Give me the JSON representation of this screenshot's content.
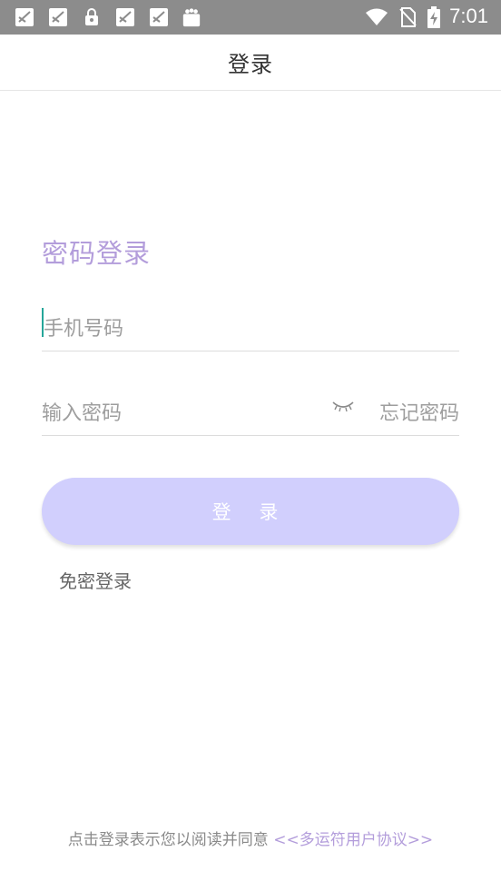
{
  "status_bar": {
    "time": "7:01",
    "left_icons": [
      "notification-icon",
      "notification-icon",
      "lock-icon",
      "notification-icon",
      "notification-icon",
      "shopping-bag-icon"
    ],
    "right_icons": [
      "wifi-icon",
      "sim-card-icon",
      "battery-charging-icon"
    ]
  },
  "header": {
    "title": "登录"
  },
  "login_form": {
    "heading": "密码登录",
    "phone_placeholder": "手机号码",
    "password_placeholder": "输入密码",
    "forgot_password": "忘记密码",
    "submit_label": "登 录",
    "sms_login": "免密登录"
  },
  "footer": {
    "agreement_text": "点击登录表示您以阅读并同意",
    "agreement_link": "<<多运符用户协议>>"
  },
  "colors": {
    "accent": "#b39ddb",
    "button_bg": "#d1cffd",
    "status_bar": "#8c8c8c",
    "caret": "#26a69a"
  }
}
